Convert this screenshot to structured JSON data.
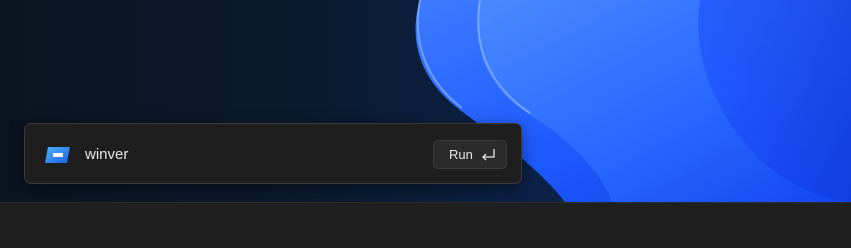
{
  "run_dialog": {
    "command": "winver",
    "run_label": "Run",
    "app_icon": "winver-app-icon",
    "enter_icon": "enter-key-icon"
  },
  "colors": {
    "wallpaper_blue": "#1f5cff",
    "box_background": "#1e1e1e",
    "taskbar": "#1f1f1f"
  }
}
